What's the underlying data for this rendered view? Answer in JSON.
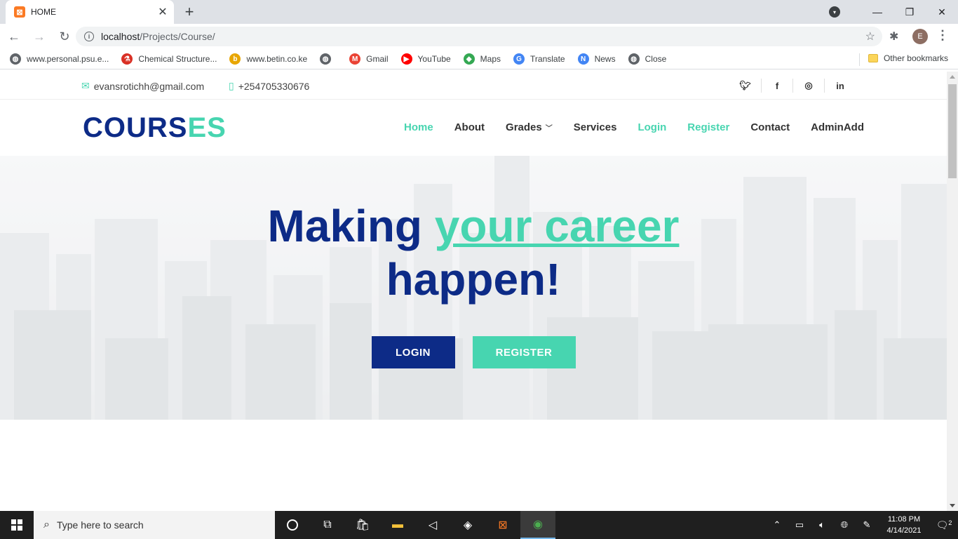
{
  "browser": {
    "tab_title": "HOME",
    "tab_favicon": "xampp-icon",
    "url_host": "localhost",
    "url_path": "/Projects/Course/",
    "profile_initial": "E",
    "bookmarks": [
      {
        "label": "www.personal.psu.e...",
        "icon": "globe-icon",
        "color": "#5f6368"
      },
      {
        "label": "Chemical Structure...",
        "icon": "chemical-icon",
        "color": "#d93025"
      },
      {
        "label": "www.betin.co.ke",
        "icon": "betin-icon",
        "color": "#e8a600"
      },
      {
        "label": "",
        "icon": "globe-icon",
        "color": "#5f6368"
      },
      {
        "label": "Gmail",
        "icon": "gmail-icon",
        "color": "#ea4335"
      },
      {
        "label": "YouTube",
        "icon": "youtube-icon",
        "color": "#ff0000"
      },
      {
        "label": "Maps",
        "icon": "maps-icon",
        "color": "#34a853"
      },
      {
        "label": "Translate",
        "icon": "translate-icon",
        "color": "#4285f4"
      },
      {
        "label": "News",
        "icon": "news-icon",
        "color": "#4285f4"
      },
      {
        "label": "Close",
        "icon": "globe-icon",
        "color": "#5f6368"
      }
    ],
    "other_bookmarks": "Other bookmarks"
  },
  "topbar": {
    "email": "evansrotichh@gmail.com",
    "phone": "+254705330676",
    "socials": [
      "twitter-icon",
      "facebook-icon",
      "instagram-icon",
      "linkedin-icon"
    ]
  },
  "header": {
    "logo_main": "COURS",
    "logo_accent": "ES",
    "nav": [
      {
        "label": "Home",
        "active": true
      },
      {
        "label": "About",
        "active": false
      },
      {
        "label": "Grades",
        "active": false
      },
      {
        "label": "Services",
        "active": false
      },
      {
        "label": "Login",
        "active": true
      },
      {
        "label": "Register",
        "active": true
      },
      {
        "label": "Contact",
        "active": false
      },
      {
        "label": "AdminAdd",
        "active": false
      }
    ]
  },
  "hero": {
    "title_part1": "Making ",
    "title_highlight": "your career",
    "title_part2": "happen!",
    "login_label": "LOGIN",
    "register_label": "REGISTER"
  },
  "colors": {
    "brand_navy": "#0d2b87",
    "brand_green": "#47d5b0"
  },
  "taskbar": {
    "search_placeholder": "Type here to search",
    "time": "11:08 PM",
    "date": "4/14/2021",
    "notification_count": "2"
  }
}
